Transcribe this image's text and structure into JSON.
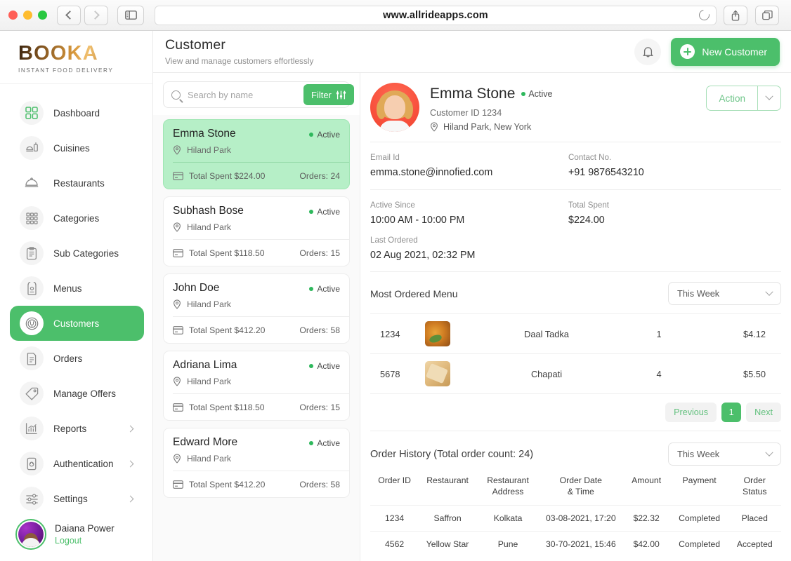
{
  "browser": {
    "url": "www.allrideapps.com",
    "back_icon": "back-chevron-icon",
    "forward_icon": "forward-chevron-icon",
    "sidebar_icon": "sidebar-toggle-icon",
    "reload_icon": "reload-icon",
    "share_icon": "share-icon",
    "tabs_icon": "tabs-icon"
  },
  "brand": {
    "name": "BOOKA",
    "tagline": "INSTANT FOOD DELIVERY"
  },
  "sidebar": {
    "items": [
      {
        "label": "Dashboard",
        "icon": "grid-icon",
        "active": false,
        "arrow": false
      },
      {
        "label": "Cuisines",
        "icon": "cuisine-icon",
        "active": false,
        "arrow": false
      },
      {
        "label": "Restaurants",
        "icon": "cloche-icon",
        "active": false,
        "arrow": false
      },
      {
        "label": "Categories",
        "icon": "grid9-icon",
        "active": false,
        "arrow": false
      },
      {
        "label": "Sub Categories",
        "icon": "clipboard-icon",
        "active": false,
        "arrow": false
      },
      {
        "label": "Menus",
        "icon": "menu-card-icon",
        "active": false,
        "arrow": false
      },
      {
        "label": "Customers",
        "icon": "customers-icon",
        "active": true,
        "arrow": false
      },
      {
        "label": "Orders",
        "icon": "orders-icon",
        "active": false,
        "arrow": false
      },
      {
        "label": "Manage Offers",
        "icon": "offer-tag-icon",
        "active": false,
        "arrow": false
      },
      {
        "label": "Reports",
        "icon": "chart-bar-icon",
        "active": false,
        "arrow": true
      },
      {
        "label": "Authentication",
        "icon": "auth-lock-icon",
        "active": false,
        "arrow": true
      },
      {
        "label": "Settings",
        "icon": "sliders-icon",
        "active": false,
        "arrow": true
      }
    ],
    "profile": {
      "name": "Daiana Power",
      "logout": "Logout",
      "avatar": "user-avatar"
    }
  },
  "header": {
    "title": "Customer",
    "subtitle": "View and manage customers effortlessly",
    "bell_icon": "bell-icon",
    "new_customer_label": "New Customer"
  },
  "search": {
    "placeholder": "Search by name",
    "value": "",
    "search_icon": "search-icon",
    "filter_label": "Filter",
    "filter_icon": "filter-sliders-icon"
  },
  "customers": [
    {
      "name": "Emma Stone",
      "status": "Active",
      "location": "Hiland Park",
      "spent_label": "Total Spent $224.00",
      "orders_label": "Orders: 24",
      "selected": true
    },
    {
      "name": "Subhash Bose",
      "status": "Active",
      "location": "Hiland Park",
      "spent_label": "Total Spent $118.50",
      "orders_label": "Orders: 15",
      "selected": false
    },
    {
      "name": "John Doe",
      "status": "Active",
      "location": "Hiland Park",
      "spent_label": "Total Spent $412.20",
      "orders_label": "Orders: 58",
      "selected": false
    },
    {
      "name": "Adriana Lima",
      "status": "Active",
      "location": "Hiland Park",
      "spent_label": "Total Spent $118.50",
      "orders_label": "Orders: 15",
      "selected": false
    },
    {
      "name": "Edward More",
      "status": "Active",
      "location": "Hiland Park",
      "spent_label": "Total Spent $412.20",
      "orders_label": "Orders: 58",
      "selected": false
    }
  ],
  "detail": {
    "name": "Emma Stone",
    "status": "Active",
    "customer_id": "Customer  ID 1234",
    "location": "Hiland Park, New York",
    "action_label": "Action",
    "action_caret_icon": "chevron-down-icon",
    "location_icon": "map-pin-icon",
    "fields": {
      "email_label": "Email Id",
      "email_value": "emma.stone@innofied.com",
      "contact_label": "Contact No.",
      "contact_value": "+91 9876543210",
      "active_since_label": "Active Since",
      "active_since_value": "10:00 AM - 10:00 PM",
      "total_spent_label": "Total Spent",
      "total_spent_value": "$224.00",
      "last_ordered_label": "Last Ordered",
      "last_ordered_value": "02 Aug 2021, 02:32 PM"
    },
    "most_ordered": {
      "title": "Most Ordered Menu",
      "filter_value": "This Week",
      "rows": [
        {
          "id": "1234",
          "thumb": "daal-tadka-photo",
          "name": "Daal Tadka",
          "qty": "1",
          "price": "$4.12"
        },
        {
          "id": "5678",
          "thumb": "chapati-photo",
          "name": "Chapati",
          "qty": "4",
          "price": "$5.50"
        }
      ],
      "pagination": {
        "previous": "Previous",
        "current": "1",
        "next": "Next"
      }
    },
    "order_history": {
      "title": "Order History (Total order count: 24)",
      "filter_value": "This Week",
      "columns": [
        "Order ID",
        "Restaurant",
        "Restaurant Address",
        "Order Date & Time",
        "Amount",
        "Payment",
        "Order Status"
      ],
      "columns_l1": [
        "Order ID",
        "Restaurant",
        "Restaurant",
        "Order Date",
        "Amount",
        "Payment",
        "Order"
      ],
      "columns_l2": [
        "",
        "",
        "Address",
        "& Time",
        "",
        "",
        "Status"
      ],
      "rows": [
        {
          "order_id": "1234",
          "restaurant": "Saffron",
          "address": "Kolkata",
          "datetime": "03-08-2021, 17:20",
          "amount": "$22.32",
          "payment": "Completed",
          "status": "Placed"
        },
        {
          "order_id": "4562",
          "restaurant": "Yellow Star",
          "address": "Pune",
          "datetime": "30-70-2021, 15:46",
          "amount": "$42.00",
          "payment": "Completed",
          "status": "Accepted"
        }
      ]
    }
  },
  "colors": {
    "accent_green": "#4cbf6b",
    "selected_card": "#b6efc7",
    "status_dot": "#2eb85c",
    "avatar_red": "#f8503c",
    "avatar_purple": "#7b1fa2"
  }
}
